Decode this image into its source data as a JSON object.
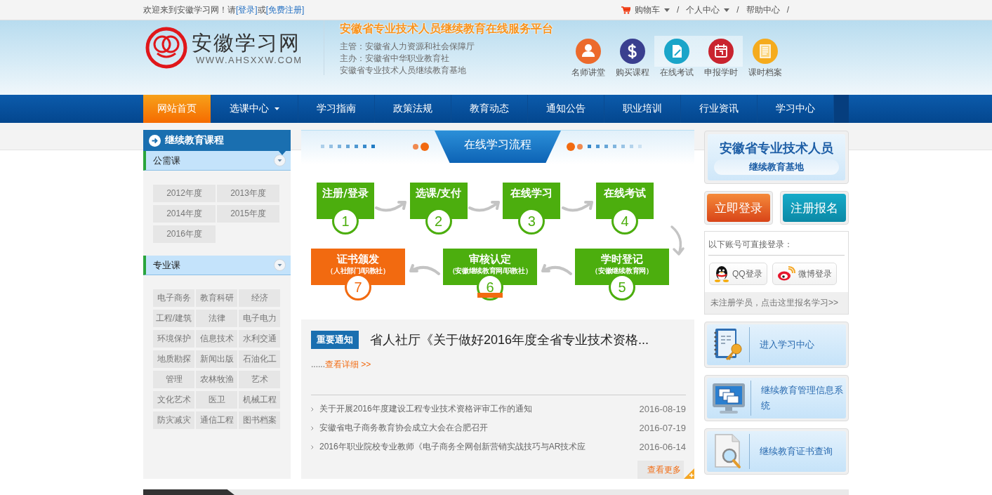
{
  "top_bar": {
    "greeting": "欢迎来到安徽学习网！请",
    "login_link": "[登录]",
    "conjunction": "或",
    "register_link": "[免费注册]",
    "menu": [
      {
        "label": "购物车",
        "kind": "cart",
        "dropdown": true,
        "separator": "/"
      },
      {
        "label": "个人中心",
        "kind": "plain",
        "dropdown": true,
        "separator": "/"
      },
      {
        "label": "帮助中心",
        "kind": "plain",
        "dropdown": false,
        "separator": "/"
      }
    ]
  },
  "header": {
    "logo_name": "安徽学习网",
    "logo_url": "WWW.AHSXXW.COM",
    "platform_title": "安徽省专业技术人员继续教育在线服务平台",
    "org_lines": [
      "主管：安徽省人力资源和社会保障厅",
      "主办：安徽省中华职业教育社",
      "安徽省专业技术人员继续教育基地"
    ],
    "quick_links": [
      {
        "label": "名师讲堂",
        "kind": "person",
        "color": "#ec6a2c",
        "highlighted": false
      },
      {
        "label": "购买课程",
        "kind": "dollar",
        "color": "#3a3f8f",
        "highlighted": false
      },
      {
        "label": "在线考试",
        "kind": "document",
        "color": "#1aa5c9",
        "highlighted": true
      },
      {
        "label": "申报学时",
        "kind": "calendar",
        "color": "#c9242f",
        "highlighted": true
      },
      {
        "label": "课时档案",
        "kind": "file",
        "color": "#f5ab1d",
        "highlighted": false
      }
    ]
  },
  "nav": {
    "items": [
      {
        "label": "网站首页",
        "selected": true,
        "dropdown": false
      },
      {
        "label": "选课中心",
        "selected": false,
        "dropdown": true
      },
      {
        "label": "学习指南",
        "selected": false,
        "dropdown": false
      },
      {
        "label": "政策法规",
        "selected": false,
        "dropdown": false
      },
      {
        "label": "教育动态",
        "selected": false,
        "dropdown": false
      },
      {
        "label": "通知公告",
        "selected": false,
        "dropdown": false
      },
      {
        "label": "职业培训",
        "selected": false,
        "dropdown": false
      },
      {
        "label": "行业资讯",
        "selected": false,
        "dropdown": false
      },
      {
        "label": "学习中心",
        "selected": false,
        "dropdown": false
      }
    ]
  },
  "left_panel": {
    "title": "继续教育课程",
    "sections": [
      {
        "title": "公需课",
        "expanded": true,
        "kind": "years",
        "items": [
          "2012年度",
          "2013年度",
          "2014年度",
          "2015年度",
          "2016年度"
        ]
      },
      {
        "title": "专业课",
        "expanded": true,
        "kind": "subjects",
        "items": [
          "电子商务",
          "教育科研",
          "经济",
          "工程/建筑",
          "法律",
          "电子电力",
          "环境保护",
          "信息技术",
          "水利交通",
          "地质勘探",
          "新闻出版",
          "石油化工",
          "管理",
          "农林牧渔",
          "艺术",
          "文化艺术",
          "医卫",
          "机械工程",
          "防灾减灾",
          "通信工程",
          "图书档案"
        ]
      }
    ]
  },
  "flow": {
    "title": "在线学习流程",
    "steps": [
      {
        "title": "注册/登录",
        "number": "1",
        "color": "#4cae0e",
        "selected": false
      },
      {
        "title": "选课/支付",
        "number": "2",
        "color": "#4cae0e",
        "selected": false
      },
      {
        "title": "在线学习",
        "number": "3",
        "color": "#4cae0e",
        "selected": false
      },
      {
        "title": "在线考试",
        "number": "4",
        "color": "#4cae0e",
        "selected": false
      },
      {
        "title": "证书颁发",
        "subtitle": "（人社部门/职教社）",
        "number": "7",
        "color": "#f26a10",
        "selected": false
      },
      {
        "title": "审核认定",
        "subtitle": "（安徽继续教育网/职教社）",
        "number": "6",
        "color": "#4cae0e",
        "selected": true
      },
      {
        "title": "学时登记",
        "subtitle": "（安徽继续教育网）",
        "number": "5",
        "color": "#4cae0e",
        "selected": false
      }
    ]
  },
  "notice": {
    "badge": "重要通知",
    "headline": "省人社厅《关于做好2016年度全省专业技术资格...",
    "ellipsis": "......",
    "details_link": "查看详细 >>",
    "news": [
      {
        "title": "关于开展2016年度建设工程专业技术资格评审工作的通知",
        "date": "2016-08-19"
      },
      {
        "title": "安徽省电子商务教育协会成立大会在合肥召开",
        "date": "2016-07-19"
      },
      {
        "title": "2016年职业院校专业教师《电子商务全网创新营销实战技巧与AR技术应",
        "date": "2016-06-14"
      }
    ],
    "more_button": "查看更多"
  },
  "right_panel": {
    "base_card": {
      "title": "安徽省专业技术人员",
      "subtitle": "继续教育基地"
    },
    "action_buttons": [
      {
        "label": "立即登录",
        "kind": "login"
      },
      {
        "label": "注册报名",
        "kind": "register"
      }
    ],
    "social": {
      "heading": "以下账号可直接登录：",
      "buttons": [
        {
          "label": "QQ登录",
          "kind": "qq"
        },
        {
          "label": "微博登录",
          "kind": "weibo"
        }
      ],
      "signup_link": "未注册学员，点击这里报名学习>>"
    },
    "tiles": [
      {
        "label": "进入学习中心",
        "kind": "study"
      },
      {
        "label": "继续教育管理信息系统",
        "kind": "system"
      },
      {
        "label": "继续教育证书查询",
        "kind": "certificate"
      }
    ]
  }
}
